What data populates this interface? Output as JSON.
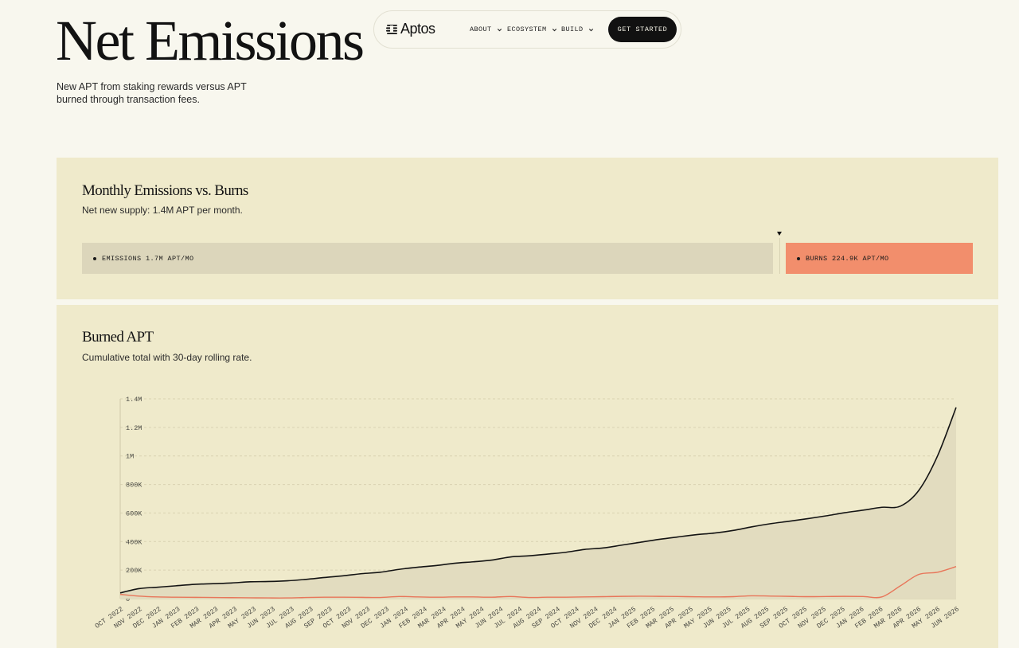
{
  "page": {
    "title": "Net Emissions",
    "subtitle": "New APT from staking rewards versus APT burned through transaction fees."
  },
  "nav": {
    "logo_text": "Aptos",
    "items": [
      {
        "label": "ABOUT"
      },
      {
        "label": "ECOSYSTEM"
      },
      {
        "label": "BUILD"
      }
    ],
    "cta_label": "GET STARTED"
  },
  "monthly": {
    "title": "Monthly Emissions vs. Burns",
    "subtitle": "Net new supply: 1.4M APT per month.",
    "emissions_label": "EMISSIONS 1.7M APT/MO",
    "burns_label": "BURNS 224.9K APT/MO",
    "colors": {
      "emissions": "#dcd6bb",
      "burns": "#f28e6c"
    }
  },
  "burned": {
    "title": "Burned APT",
    "subtitle": "Cumulative total with 30-day rolling rate."
  },
  "chart_data": {
    "type": "area",
    "ylim": [
      0,
      1400000
    ],
    "y_ticks": [
      {
        "value": 0,
        "label": "0"
      },
      {
        "value": 200000,
        "label": "200K"
      },
      {
        "value": 400000,
        "label": "400K"
      },
      {
        "value": 600000,
        "label": "600K"
      },
      {
        "value": 800000,
        "label": "800K"
      },
      {
        "value": 1000000,
        "label": "1M"
      },
      {
        "value": 1200000,
        "label": "1.2M"
      },
      {
        "value": 1400000,
        "label": "1.4M"
      }
    ],
    "x": [
      "OCT 2022",
      "NOV 2022",
      "DEC 2022",
      "JAN 2023",
      "FEB 2023",
      "MAR 2023",
      "APR 2023",
      "MAY 2023",
      "JUN 2023",
      "JUL 2023",
      "AUG 2023",
      "SEP 2023",
      "OCT 2023",
      "NOV 2023",
      "DEC 2023",
      "JAN 2024",
      "FEB 2024",
      "MAR 2024",
      "APR 2024",
      "MAY 2024",
      "JUN 2024",
      "JUL 2024",
      "AUG 2024",
      "SEP 2024",
      "OCT 2024",
      "NOV 2024",
      "DEC 2024",
      "JAN 2025",
      "FEB 2025",
      "MAR 2025",
      "APR 2025",
      "MAY 2025",
      "JUN 2025",
      "JUL 2025",
      "AUG 2025",
      "SEP 2025",
      "OCT 2025",
      "NOV 2025",
      "DEC 2025",
      "JAN 2026",
      "FEB 2026",
      "MAR 2026",
      "APR 2026",
      "MAY 2026",
      "JUN 2026"
    ],
    "series": [
      {
        "color": "#141414",
        "fill": "#e2dcbf",
        "values": [
          40000,
          70000,
          80000,
          90000,
          100000,
          105000,
          110000,
          118000,
          120000,
          125000,
          135000,
          148000,
          160000,
          175000,
          185000,
          205000,
          220000,
          232000,
          248000,
          258000,
          270000,
          292000,
          300000,
          312000,
          325000,
          345000,
          355000,
          375000,
          395000,
          415000,
          432000,
          448000,
          460000,
          478000,
          503000,
          525000,
          542000,
          560000,
          580000,
          602000,
          620000,
          640000,
          648000,
          760000,
          1000000,
          1340000
        ]
      },
      {
        "color": "#e8765a",
        "values": [
          30000,
          18000,
          12000,
          10000,
          9000,
          8000,
          7000,
          6000,
          5000,
          5000,
          8000,
          10000,
          10000,
          9000,
          8000,
          15000,
          12000,
          10000,
          12000,
          12000,
          10000,
          15000,
          8000,
          10000,
          10000,
          12000,
          14000,
          16000,
          17000,
          16000,
          15000,
          13000,
          12000,
          14000,
          20000,
          18000,
          16000,
          14000,
          15000,
          16000,
          15000,
          12000,
          90000,
          170000,
          185000,
          225000
        ]
      }
    ]
  }
}
